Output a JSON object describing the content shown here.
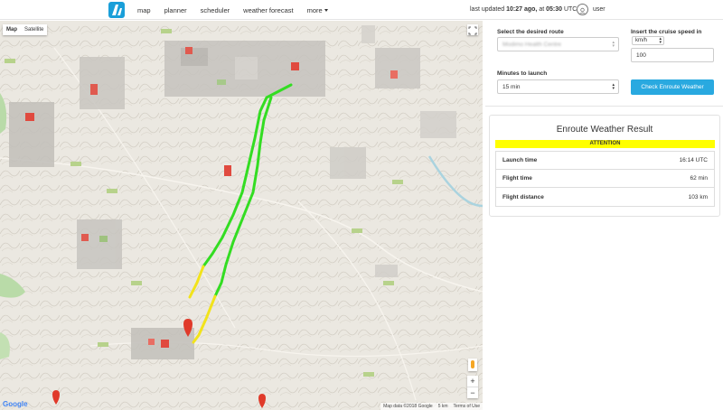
{
  "nav": {
    "items": [
      "map",
      "planner",
      "scheduler",
      "weather forecast",
      "more"
    ],
    "updated_prefix": "last updated",
    "updated_ago": "10:27 ago,",
    "updated_at": "at",
    "updated_time": "05:30",
    "updated_tz": "UTC",
    "user": "user"
  },
  "map": {
    "type_map": "Map",
    "type_satellite": "Satellite",
    "zoom_in": "+",
    "zoom_out": "−",
    "attribution": "Map data ©2018 Google",
    "scale": "5 km",
    "terms": "Terms of Use",
    "google": "Google",
    "route_colors": {
      "safe": "#33dd22",
      "caution": "#f2e31b",
      "marker": "#e03a2a"
    }
  },
  "form": {
    "route_label": "Select the desired route",
    "route_value": "Modimo Health Centre",
    "speed_label": "Insert the cruise speed in",
    "speed_unit": "km/h",
    "speed_value": "100",
    "minutes_label": "Minutes to launch",
    "minutes_value": "15 min",
    "check_button": "Check Enroute Weather"
  },
  "result": {
    "title": "Enroute Weather Result",
    "status": "ATTENTION",
    "status_color": "#ffff00",
    "rows": [
      {
        "label": "Launch time",
        "value": "16:14 UTC"
      },
      {
        "label": "Flight time",
        "value": "62 min"
      },
      {
        "label": "Flight distance",
        "value": "103 km"
      }
    ]
  }
}
